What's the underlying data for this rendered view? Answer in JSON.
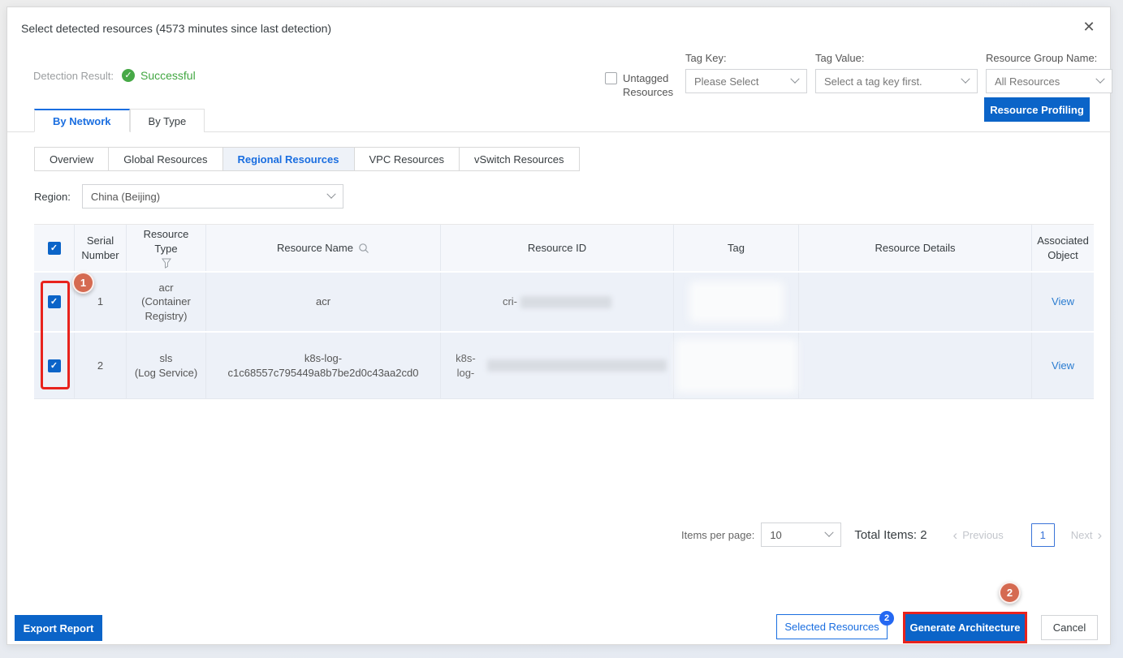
{
  "modal": {
    "title": "Select detected resources (4573 minutes since last detection)",
    "close": "✕"
  },
  "detection": {
    "label": "Detection Result:",
    "check": "✓",
    "status": "Successful"
  },
  "filters": {
    "untagged_label": "Untagged Resources",
    "tag_key": {
      "label": "Tag Key:",
      "value": "Please Select"
    },
    "tag_value": {
      "label": "Tag Value:",
      "value": "Select a tag key first."
    },
    "resource_group": {
      "label": "Resource Group Name:",
      "value": "All Resources"
    },
    "resource_profiling": "Resource Profiling"
  },
  "tabs": [
    {
      "label": "By Network",
      "active": true
    },
    {
      "label": "By Type",
      "active": false
    }
  ],
  "subtabs": [
    {
      "label": "Overview",
      "active": false
    },
    {
      "label": "Global Resources",
      "active": false
    },
    {
      "label": "Regional Resources",
      "active": true
    },
    {
      "label": "VPC Resources",
      "active": false
    },
    {
      "label": "vSwitch Resources",
      "active": false
    }
  ],
  "region": {
    "label": "Region:",
    "value": "China (Beijing)"
  },
  "table": {
    "headers": [
      "Serial Number",
      "Resource Type",
      "Resource Name",
      "Resource ID",
      "Tag",
      "Resource Details",
      "Associated Object"
    ],
    "rows": [
      {
        "serial": "1",
        "type_line1": "acr",
        "type_line2": "(Container Registry)",
        "name": "acr",
        "id_prefix": "cri-",
        "id_redacted": true,
        "tag_redacted": true,
        "details": "",
        "action": "View",
        "checked": true
      },
      {
        "serial": "2",
        "type_line1": "sls",
        "type_line2": "(Log Service)",
        "name": "k8s-log-c1c68557c795449a8b7be2d0c43aa2cd0",
        "id_prefix": "k8s-log-",
        "id_redacted": true,
        "tag_redacted": true,
        "details": "",
        "action": "View",
        "checked": true
      }
    ]
  },
  "pagination": {
    "items_per_page_label": "Items per page:",
    "items_per_page": "10",
    "total": "Total Items: 2",
    "previous": "Previous",
    "page": "1",
    "next": "Next",
    "prev_arrow": "‹",
    "next_arrow": "›"
  },
  "footer": {
    "export": "Export Report",
    "selected_resources": "Selected Resources",
    "selected_badge": "2",
    "generate": "Generate Architecture",
    "cancel": "Cancel"
  },
  "annotations": {
    "step1": "1",
    "step2": "2"
  },
  "colors": {
    "primary_blue": "#0b64c8",
    "link_blue": "#2a7cd0",
    "active_tab_blue": "#1a6ee0",
    "success_green": "#47a947",
    "annotation_red": "#e8231d",
    "annotation_circle": "#d56a51",
    "row_bg": "#edf1f8",
    "header_bg": "#f5f7fb"
  }
}
